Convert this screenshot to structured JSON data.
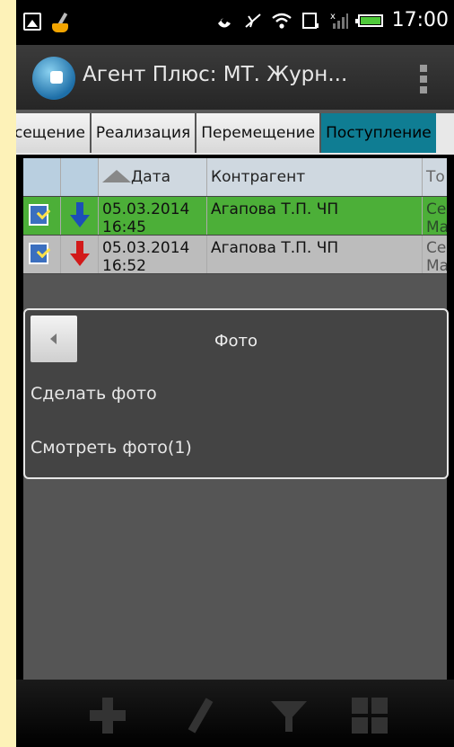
{
  "status_bar": {
    "time": "17:00",
    "icons": [
      "gallery-icon",
      "broom-icon",
      "call-icon",
      "no-sound-icon",
      "wifi-icon",
      "sd-card-icon",
      "signal-icon",
      "battery-icon"
    ]
  },
  "action_bar": {
    "title": "Агент Плюс: МТ. Журн...",
    "logo_icon": "app-logo-icon",
    "overflow_icon": "overflow-menu-icon"
  },
  "tabs": [
    {
      "label": "сещение",
      "active": false
    },
    {
      "label": "Реализация",
      "active": false
    },
    {
      "label": "Перемещение",
      "active": false
    },
    {
      "label": "Поступление",
      "active": true
    }
  ],
  "grid": {
    "headers": {
      "col1": "",
      "col2": "",
      "date": "Дата",
      "contractor": "Контрагент",
      "col5": "То"
    },
    "rows": [
      {
        "date": "05.03.2014\n16:45",
        "contractor": "Агапова Т.П. ЧП",
        "col5": "Се\nМа",
        "status": "green",
        "arrow": "blue"
      },
      {
        "date": "05.03.2014\n16:52",
        "contractor": "Агапова Т.П. ЧП",
        "col5": "Се\nМа",
        "status": "gray",
        "arrow": "red"
      }
    ]
  },
  "dialog": {
    "title": "Фото",
    "items": [
      "Сделать фото",
      "Смотреть фото(1)"
    ]
  },
  "bottom_bar": {
    "icons": [
      "add-icon",
      "edit-icon",
      "filter-icon",
      "grid-view-icon"
    ]
  },
  "colors": {
    "accent_tab": "#0f7d93",
    "row_green": "#4caf38",
    "arrow_blue": "#1c4fb8",
    "arrow_red": "#d21a1a"
  }
}
